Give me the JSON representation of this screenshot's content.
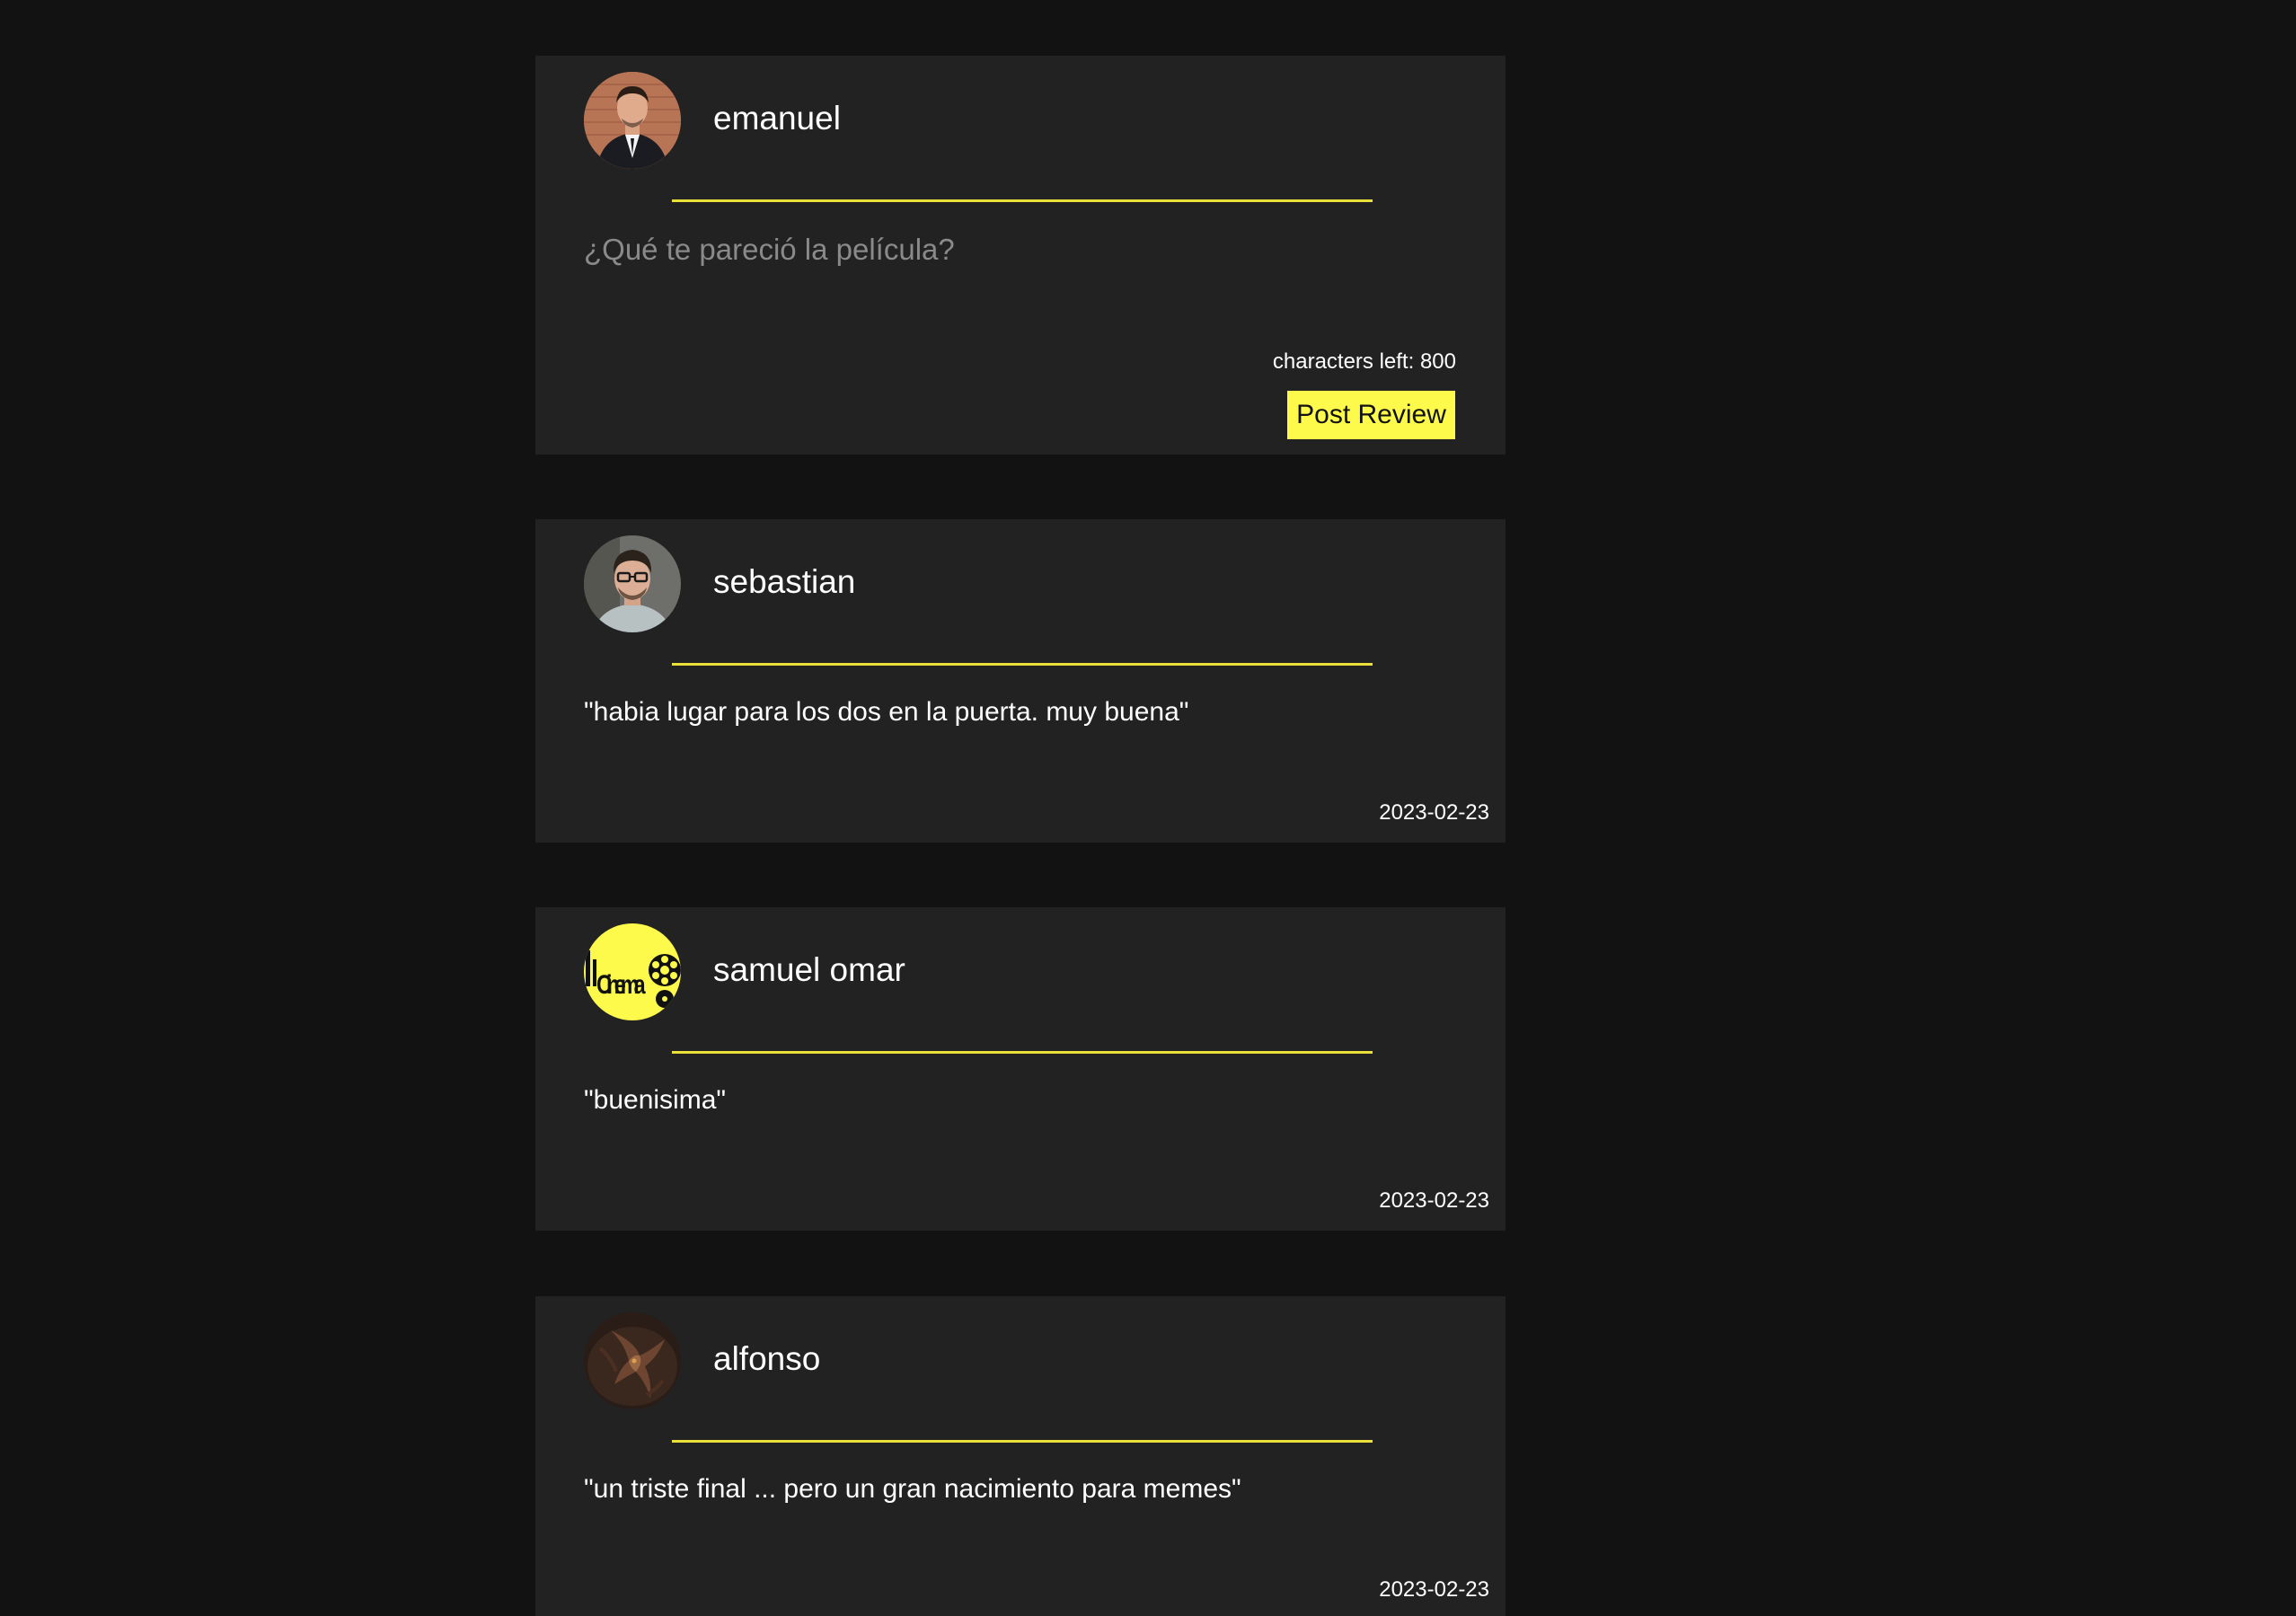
{
  "compose": {
    "username": "emanuel",
    "avatar_icon": "user-avatar-emanuel",
    "placeholder": "¿Qué te pareció la película?",
    "value": "",
    "chars_left_label": "characters left:",
    "chars_left_value": "800",
    "post_button_label": "Post Review"
  },
  "reviews": [
    {
      "username": "sebastian",
      "avatar_icon": "user-avatar-sebastian",
      "text": "\"habia lugar para los dos en la puerta. muy buena\"",
      "date": "2023-02-23"
    },
    {
      "username": "samuel omar",
      "avatar_icon": "cinema-logo-avatar",
      "avatar_logo_text": "Cinema",
      "text": "\"buenisima\"",
      "date": "2023-02-23"
    },
    {
      "username": "alfonso",
      "avatar_icon": "dragon-avatar",
      "text": "\"un triste final ... pero un gran nacimiento para memes\"",
      "date": "2023-02-23"
    }
  ],
  "colors": {
    "background": "#121212",
    "card": "#222222",
    "accent": "#fdfa4b",
    "divider": "#e8df3a",
    "placeholder": "#8a8a8a"
  }
}
